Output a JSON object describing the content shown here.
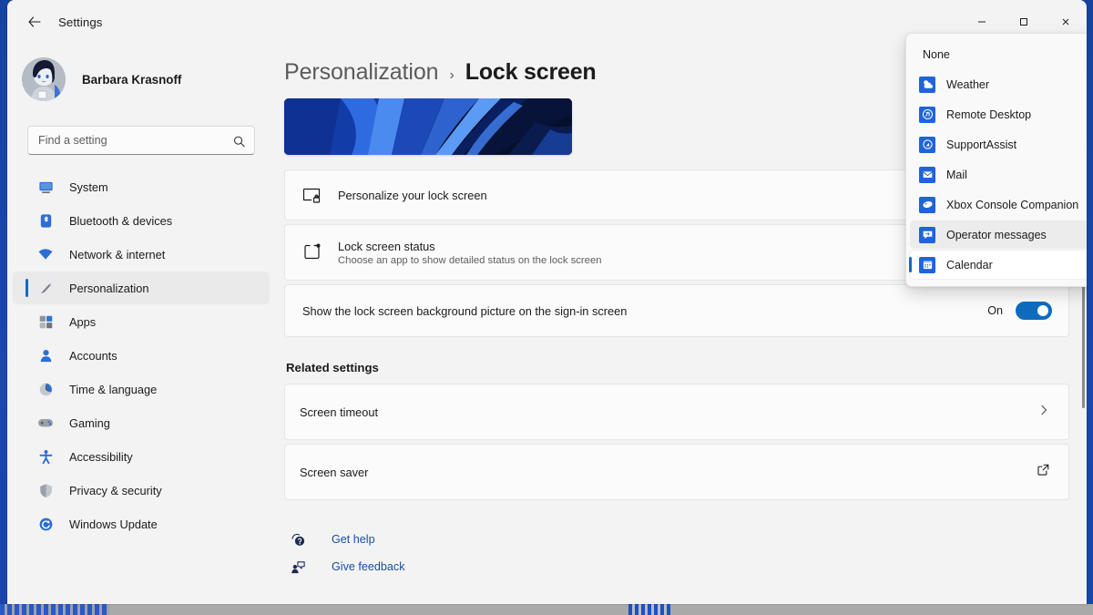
{
  "window": {
    "app_title": "Settings",
    "back_icon": "back-arrow-icon",
    "controls": {
      "minimize": "–",
      "maximize": "☐",
      "close": "✕"
    }
  },
  "sidebar": {
    "profile": {
      "name": "Barbara Krasnoff",
      "avatar_icon": "user-avatar"
    },
    "search": {
      "placeholder": "Find a setting",
      "value": "",
      "icon": "search-icon"
    },
    "items": [
      {
        "label": "System",
        "icon": "display-monitor-icon",
        "active": false
      },
      {
        "label": "Bluetooth & devices",
        "icon": "bluetooth-icon",
        "active": false
      },
      {
        "label": "Network & internet",
        "icon": "wifi-icon",
        "active": false
      },
      {
        "label": "Personalization",
        "icon": "paintbrush-icon",
        "active": true
      },
      {
        "label": "Apps",
        "icon": "apps-grid-icon",
        "active": false
      },
      {
        "label": "Accounts",
        "icon": "person-icon",
        "active": false
      },
      {
        "label": "Time & language",
        "icon": "clock-icon",
        "active": false
      },
      {
        "label": "Gaming",
        "icon": "gamepad-icon",
        "active": false
      },
      {
        "label": "Accessibility",
        "icon": "accessibility-person-icon",
        "active": false
      },
      {
        "label": "Privacy & security",
        "icon": "shield-icon",
        "active": false
      },
      {
        "label": "Windows Update",
        "icon": "update-refresh-icon",
        "active": false
      }
    ]
  },
  "main": {
    "breadcrumb": {
      "parent": "Personalization",
      "separator": "›",
      "current": "Lock screen"
    },
    "preview": {
      "name": "lock-screen-wallpaper-preview"
    },
    "cards": [
      {
        "title": "Personalize your lock screen",
        "subtitle": "",
        "icon": "lock-screen-picture-icon"
      },
      {
        "title": "Lock screen status",
        "subtitle": "Choose an app to show detailed status on the lock screen",
        "icon": "lock-screen-status-icon"
      }
    ],
    "show_background": {
      "label": "Show the lock screen background picture on the sign-in screen",
      "toggle_state": "On",
      "toggle_on": true
    },
    "related": {
      "title": "Related settings",
      "items": [
        {
          "label": "Screen timeout",
          "trailing_icon": "chevron-right-icon"
        },
        {
          "label": "Screen saver",
          "trailing_icon": "open-external-icon"
        }
      ]
    },
    "footer_links": [
      {
        "label": "Get help",
        "icon": "help-question-icon"
      },
      {
        "label": "Give feedback",
        "icon": "feedback-person-icon"
      }
    ]
  },
  "dropdown": {
    "name": "lock-screen-status-app-dropdown",
    "items": [
      {
        "label": "None",
        "icon": null,
        "state": "normal"
      },
      {
        "label": "Weather",
        "icon": "weather-app-icon",
        "state": "normal"
      },
      {
        "label": "Remote Desktop",
        "icon": "remote-desktop-app-icon",
        "state": "normal"
      },
      {
        "label": "SupportAssist",
        "icon": "supportassist-app-icon",
        "state": "normal"
      },
      {
        "label": "Mail",
        "icon": "mail-app-icon",
        "state": "normal"
      },
      {
        "label": "Xbox Console Companion",
        "icon": "xbox-app-icon",
        "state": "normal"
      },
      {
        "label": "Operator messages",
        "icon": "operator-messages-app-icon",
        "state": "hovered"
      },
      {
        "label": "Calendar",
        "icon": "calendar-app-icon",
        "state": "selected"
      }
    ]
  },
  "colors": {
    "accent": "#0f6cbd",
    "app_icon_blue": "#1f64d8",
    "window_bg": "#f3f3f3",
    "card_bg": "#fbfbfb",
    "link": "#1a4fa0",
    "desktop_blue": "#1b47ae"
  }
}
